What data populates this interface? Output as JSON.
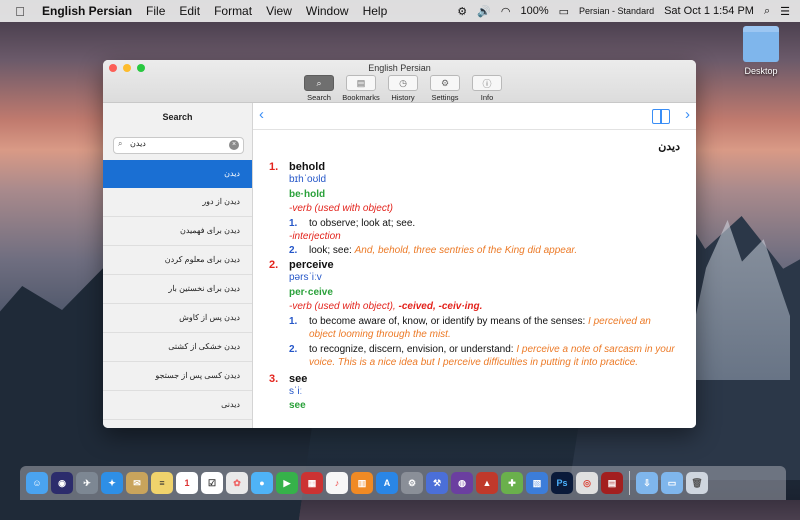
{
  "menubar": {
    "apple_icon": "apple-icon",
    "app_name": "English Persian",
    "menus": [
      "File",
      "Edit",
      "Format",
      "View",
      "Window",
      "Help"
    ],
    "battery": "100%",
    "input_source": "Persian - Standard",
    "clock": "Sat Oct 1  1:54 PM"
  },
  "desktop": {
    "folder_label": "Desktop"
  },
  "window": {
    "title": "English Persian",
    "toolbar": [
      {
        "label": "Search",
        "icon": "search-icon"
      },
      {
        "label": "Bookmarks",
        "icon": "bookmarks-icon"
      },
      {
        "label": "History",
        "icon": "history-icon"
      },
      {
        "label": "Settings",
        "icon": "gear-icon"
      },
      {
        "label": "Info",
        "icon": "info-icon"
      }
    ]
  },
  "sidebar": {
    "title": "Search",
    "search_value": "دیدن",
    "results": [
      "دیدن",
      "دیدن از دور",
      "دیدن برای فهمیدن",
      "دیدن برای معلوم کردن",
      "دیدن برای نخستین بار",
      "دیدن پس از کاوش",
      "دیدن خشکی از کشتی",
      "دیدن کسی پس از جستجو",
      "دیدنی"
    ]
  },
  "entry": {
    "headword": "دیدن",
    "senses": [
      {
        "num": "1.",
        "word": "behold",
        "pron": "bɪhˈoʊld",
        "syll": "be·hold",
        "blocks": [
          {
            "pos": "-verb (used with object)",
            "defs": [
              {
                "n": "1.",
                "text": "to observe; look at; see.",
                "ex": ""
              }
            ]
          },
          {
            "pos": "-interjection",
            "defs": [
              {
                "n": "2.",
                "text": "look; see: ",
                "ex": "And, behold, three sentries of the King did appear."
              }
            ]
          }
        ]
      },
      {
        "num": "2.",
        "word": "perceive",
        "pron": "pərsˈiːv",
        "syll": "per·ceive",
        "pos_main": "-verb (used with object), ",
        "pos_forms": "-ceived, -ceiv·ing.",
        "defs": [
          {
            "n": "1.",
            "text": "to become aware of, know, or identify by means of the senses: ",
            "ex": "I perceived an object looming through the mist."
          },
          {
            "n": "2.",
            "text": "to recognize, discern, envision, or understand: ",
            "ex": "I perceive a note of sarcasm in your voice. This is a nice idea but I perceive difficulties in putting it into practice."
          }
        ]
      },
      {
        "num": "3.",
        "word": "see",
        "pron": "sˈiː",
        "syll": "see"
      }
    ]
  },
  "dock": {
    "items": [
      "Finder",
      "Siri",
      "Launchpad",
      "Safari",
      "Mail",
      "Notes",
      "Calendar",
      "Reminders",
      "Photos",
      "Messages",
      "FaceTime",
      "iTunes",
      "iBooks",
      "App Store",
      "System Preferences",
      "Terminal",
      "Photoshop",
      "Chrome",
      "English Persian",
      "Downloads",
      "Trash"
    ],
    "calendar_day": "1"
  }
}
